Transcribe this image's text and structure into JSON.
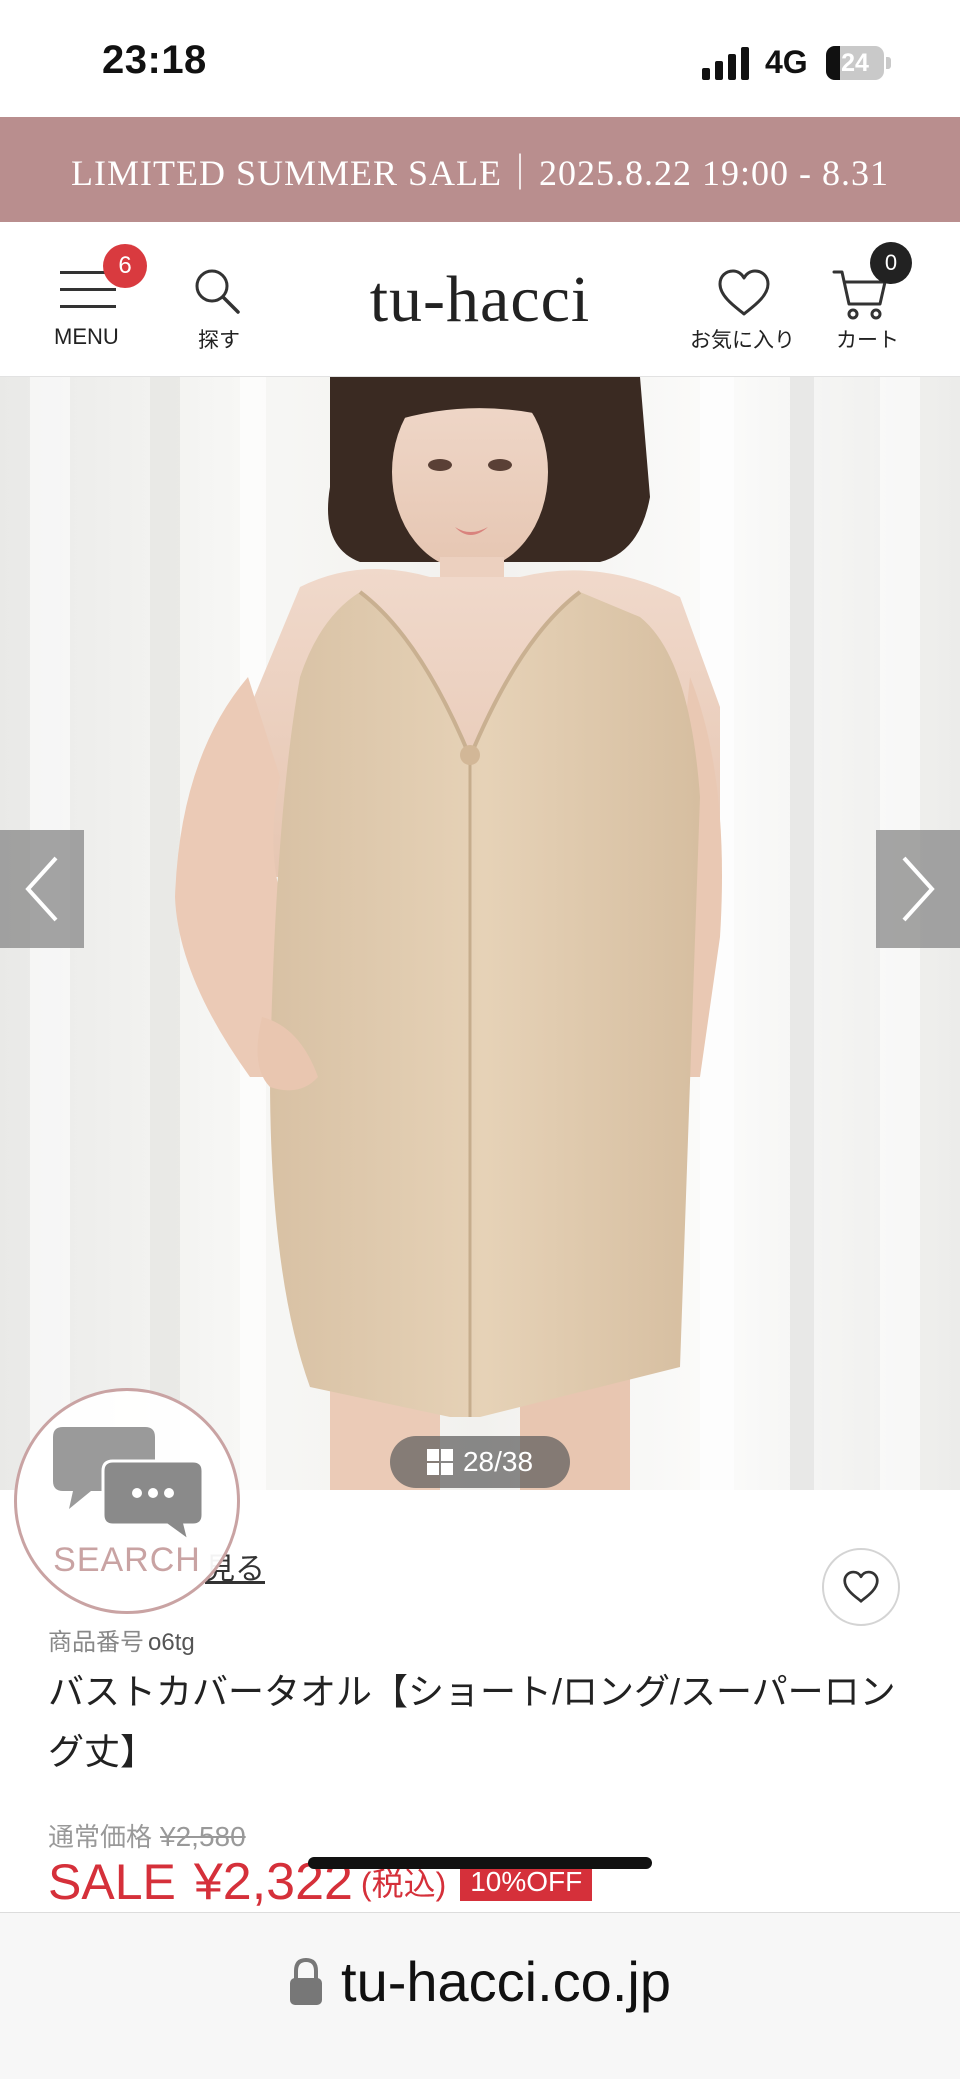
{
  "status_bar": {
    "time": "23:18",
    "network": "4G",
    "battery": "24",
    "battery_level": 0.24
  },
  "banner": {
    "text": "LIMITED SUMMER SALE｜2025.8.22 19:00 - 8.31"
  },
  "header": {
    "menu_label": "MENU",
    "menu_badge": "6",
    "search_label": "探す",
    "brand": "tu-hacci",
    "favorites_label": "お気に入り",
    "cart_label": "カート",
    "cart_badge": "0"
  },
  "gallery": {
    "counter": "28/38"
  },
  "floating_search": {
    "label": "SEARCH"
  },
  "product": {
    "see_link": "見る",
    "code_label": "商品番号",
    "code": "o6tg",
    "title": "バストカバータオル【ショート/ロング/スーパーロング丈】",
    "regular_price_label": "通常価格",
    "regular_price": "¥2,580",
    "sale_label": "SALE",
    "sale_price": "¥2,322",
    "tax_note": "(税込)",
    "discount": "10%OFF"
  },
  "browser": {
    "url": "tu-hacci.co.jp"
  },
  "colors": {
    "banner": "#b98e8e",
    "sale_red": "#d5303a",
    "badge_red": "#d93a3f",
    "search_accent": "#c9a3a3"
  }
}
